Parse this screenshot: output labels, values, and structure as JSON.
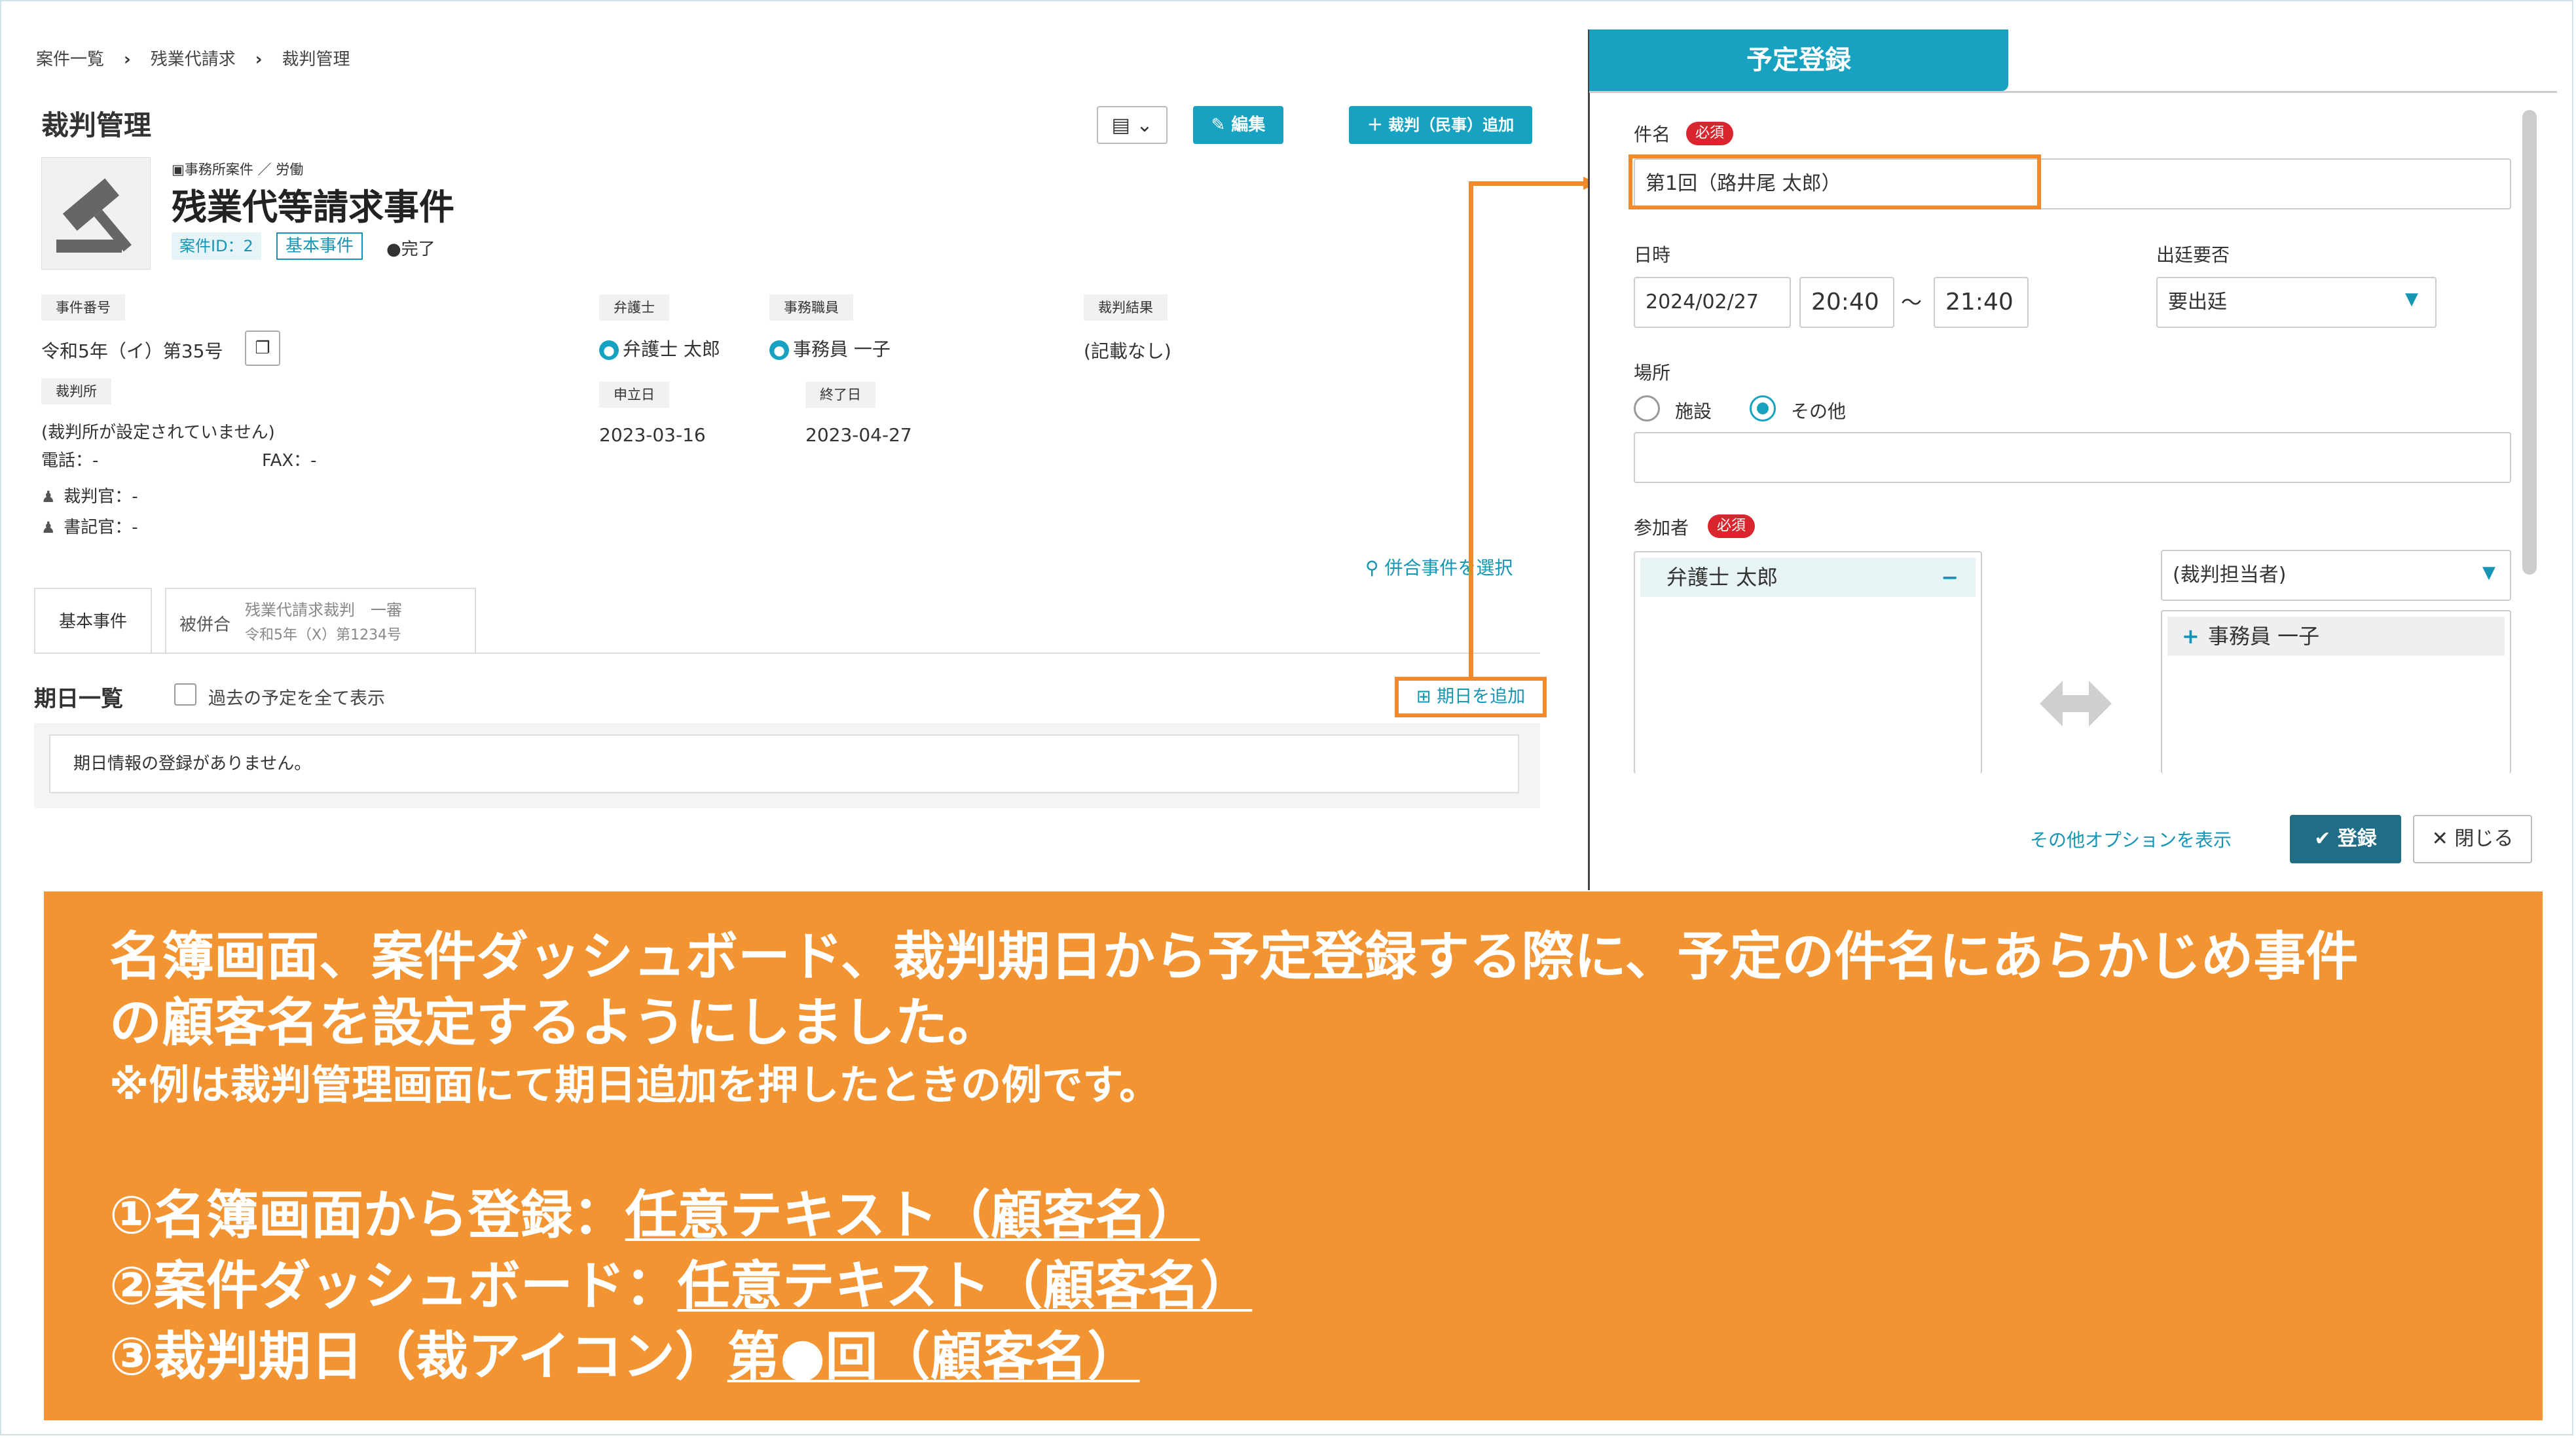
{
  "breadcrumb": [
    "案件一覧",
    "残業代請求",
    "裁判管理"
  ],
  "page_title": "裁判管理",
  "toolbar": {
    "edit_label": "編集",
    "add_case_label": "裁判（民事）追加"
  },
  "case": {
    "category": "事務所案件 ／ 労働",
    "name": "残業代等請求事件",
    "id_badge": "案件ID：2",
    "base_badge": "基本事件",
    "status": "●完了"
  },
  "fields": {
    "case_number_label": "事件番号",
    "case_number": "令和5年（イ）第35号",
    "court_label": "裁判所",
    "court_value": "(裁判所が設定されていません)",
    "tel": "電話：-",
    "fax": "FAX：-",
    "judge": "裁判官：-",
    "clerk": "書記官：-",
    "lawyer_label": "弁護士",
    "lawyer": "弁護士 太郎",
    "staff_label": "事務職員",
    "staff": "事務員 一子",
    "result_label": "裁判結果",
    "result": "(記載なし)",
    "filed_label": "申立日",
    "filed": "2023-03-16",
    "end_label": "終了日",
    "end": "2023-04-27"
  },
  "select_merged_link": "併合事件を選択",
  "tabs": {
    "base": "基本事件",
    "merged_prefix": "被併合",
    "merged_title": "残業代請求裁判　一審",
    "merged_number": "令和5年（X）第1234号"
  },
  "dates": {
    "title": "期日一覧",
    "show_past_label": "過去の予定を全て表示",
    "add_label": "期日を追加",
    "empty_message": "期日情報の登録がありません。"
  },
  "modal": {
    "tab_title": "予定登録",
    "subject_label": "件名",
    "required": "必須",
    "subject_value": "第1回（路井尾 太郎）",
    "datetime_label": "日時",
    "date": "2024/02/27",
    "start_time": "20:40",
    "tilde": "～",
    "end_time": "21:40",
    "attendance_label": "出廷要否",
    "attendance_value": "要出廷",
    "place_label": "場所",
    "place_option_facility": "施設",
    "place_option_other": "その他",
    "participants_label": "参加者",
    "selected_participant": "弁護士 太郎",
    "remove_glyph": "−",
    "filter_value": "(裁判担当者)",
    "candidate": "事務員 一子",
    "add_glyph": "+",
    "more_options": "その他オプションを表示",
    "save_label": "登録",
    "close_label": "閉じる"
  },
  "banner": {
    "line1": "名簿画面、案件ダッシュボード、裁判期日から予定登録する際に、予定の件名にあらかじめ事件",
    "line2": "の顧客名を設定するようにしました。",
    "line3": "※例は裁判管理画面にて期日追加を押したときの例です。",
    "item1_prefix": "①名簿画面から登録：",
    "item1_value": "任意テキスト（顧客名）",
    "item2_prefix": "②案件ダッシュボード：",
    "item2_value": "任意テキスト（顧客名）",
    "item3_prefix": "③裁判期日（裁アイコン）",
    "item3_value": "第●回（顧客名）"
  },
  "colors": {
    "accent": "#17a2c1",
    "highlight": "#f08a2b",
    "banner": "#f39433",
    "required": "#d9262e"
  }
}
